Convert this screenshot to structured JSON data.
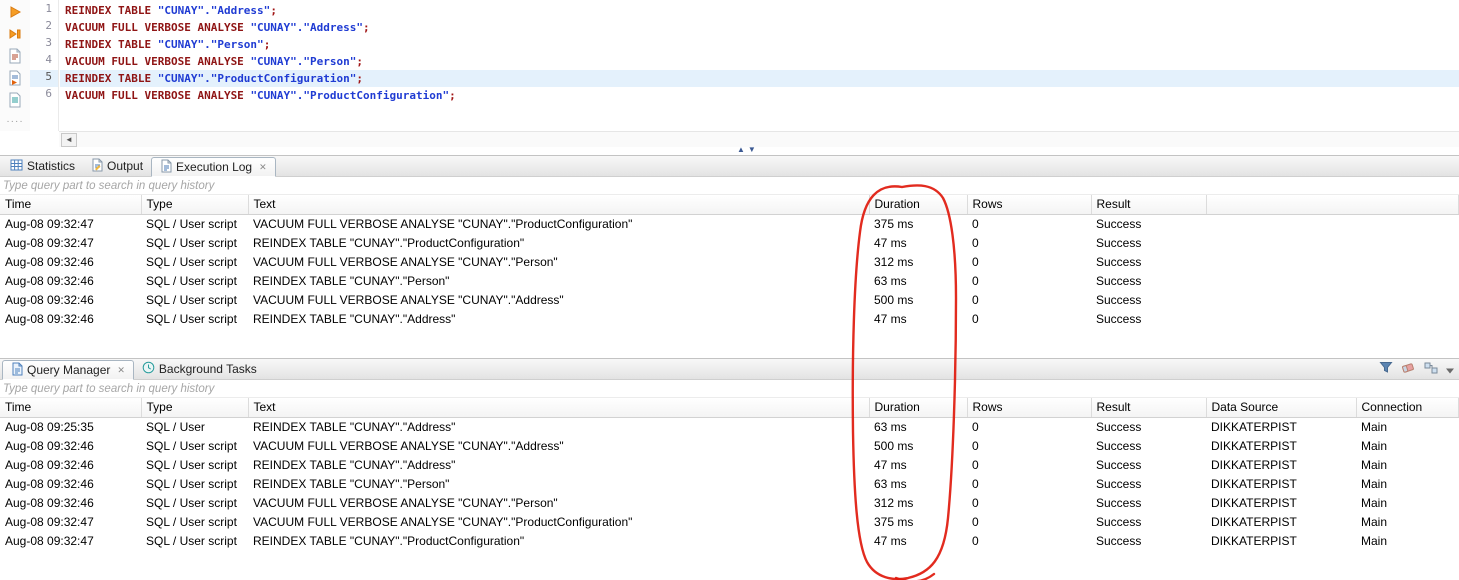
{
  "annotation": {
    "shape": "freehand-ellipse",
    "color": "#e0190c",
    "target": "Duration column values"
  },
  "editor": {
    "current_line": 5,
    "toolbar_icons": [
      "execute-statement",
      "execute-script",
      "explain-plan",
      "execute-script-file",
      "script",
      "more"
    ],
    "lines": [
      {
        "num": 1,
        "segments": [
          {
            "c": "kw",
            "t": "REINDEX TABLE "
          },
          {
            "c": "id",
            "t": "\"CUNAY\".\"Address\""
          },
          {
            "c": "pn",
            "t": ";"
          }
        ]
      },
      {
        "num": 2,
        "segments": [
          {
            "c": "kw",
            "t": "VACUUM FULL VERBOSE ANALYSE "
          },
          {
            "c": "id",
            "t": "\"CUNAY\".\"Address\""
          },
          {
            "c": "pn",
            "t": ";"
          }
        ]
      },
      {
        "num": 3,
        "segments": [
          {
            "c": "kw",
            "t": "REINDEX TABLE "
          },
          {
            "c": "id",
            "t": "\"CUNAY\".\"Person\""
          },
          {
            "c": "pn",
            "t": ";"
          }
        ]
      },
      {
        "num": 4,
        "segments": [
          {
            "c": "kw",
            "t": "VACUUM FULL VERBOSE ANALYSE "
          },
          {
            "c": "id",
            "t": "\"CUNAY\".\"Person\""
          },
          {
            "c": "pn",
            "t": ";"
          }
        ]
      },
      {
        "num": 5,
        "segments": [
          {
            "c": "kw",
            "t": "REINDEX TABLE "
          },
          {
            "c": "id",
            "t": "\"CUNAY\".\"ProductConfiguration\""
          },
          {
            "c": "pn",
            "t": ";"
          }
        ]
      },
      {
        "num": 6,
        "segments": [
          {
            "c": "kw",
            "t": "VACUUM FULL VERBOSE ANALYSE "
          },
          {
            "c": "id",
            "t": "\"CUNAY\".\"ProductConfiguration\""
          },
          {
            "c": "pn",
            "t": ";"
          }
        ]
      }
    ]
  },
  "panels": {
    "execution_log": {
      "tabs": [
        {
          "label": "Statistics"
        },
        {
          "label": "Output"
        },
        {
          "label": "Execution Log",
          "active": true,
          "closable": true
        }
      ],
      "filter_placeholder": "Type query part to search in query history",
      "columns": [
        "Time",
        "Type",
        "Text",
        "Duration",
        "Rows",
        "Result"
      ],
      "rows": [
        [
          "Aug-08 09:32:47",
          "SQL / User script",
          "VACUUM FULL VERBOSE ANALYSE \"CUNAY\".\"ProductConfiguration\"",
          "375 ms",
          "0",
          "Success"
        ],
        [
          "Aug-08 09:32:47",
          "SQL / User script",
          "REINDEX TABLE \"CUNAY\".\"ProductConfiguration\"",
          "47 ms",
          "0",
          "Success"
        ],
        [
          "Aug-08 09:32:46",
          "SQL / User script",
          "VACUUM FULL VERBOSE ANALYSE \"CUNAY\".\"Person\"",
          "312 ms",
          "0",
          "Success"
        ],
        [
          "Aug-08 09:32:46",
          "SQL / User script",
          "REINDEX TABLE \"CUNAY\".\"Person\"",
          "63 ms",
          "0",
          "Success"
        ],
        [
          "Aug-08 09:32:46",
          "SQL / User script",
          "VACUUM FULL VERBOSE ANALYSE \"CUNAY\".\"Address\"",
          "500 ms",
          "0",
          "Success"
        ],
        [
          "Aug-08 09:32:46",
          "SQL / User script",
          "REINDEX TABLE \"CUNAY\".\"Address\"",
          "47 ms",
          "0",
          "Success"
        ]
      ]
    },
    "query_manager": {
      "tabs": [
        {
          "label": "Query Manager",
          "active": true,
          "closable": true
        },
        {
          "label": "Background Tasks"
        }
      ],
      "toolbar_icons": [
        "filter-funnel",
        "clear-eraser",
        "transfer",
        "view-menu-chevron"
      ],
      "filter_placeholder": "Type query part to search in query history",
      "columns": [
        "Time",
        "Type",
        "Text",
        "Duration",
        "Rows",
        "Result",
        "Data Source",
        "Connection"
      ],
      "rows": [
        [
          "Aug-08 09:25:35",
          "SQL / User",
          "REINDEX TABLE \"CUNAY\".\"Address\"",
          "63 ms",
          "0",
          "Success",
          "DIKKATERPIST",
          "Main"
        ],
        [
          "Aug-08 09:32:46",
          "SQL / User script",
          "VACUUM FULL VERBOSE ANALYSE \"CUNAY\".\"Address\"",
          "500 ms",
          "0",
          "Success",
          "DIKKATERPIST",
          "Main"
        ],
        [
          "Aug-08 09:32:46",
          "SQL / User script",
          "REINDEX TABLE \"CUNAY\".\"Address\"",
          "47 ms",
          "0",
          "Success",
          "DIKKATERPIST",
          "Main"
        ],
        [
          "Aug-08 09:32:46",
          "SQL / User script",
          "REINDEX TABLE \"CUNAY\".\"Person\"",
          "63 ms",
          "0",
          "Success",
          "DIKKATERPIST",
          "Main"
        ],
        [
          "Aug-08 09:32:46",
          "SQL / User script",
          "VACUUM FULL VERBOSE ANALYSE \"CUNAY\".\"Person\"",
          "312 ms",
          "0",
          "Success",
          "DIKKATERPIST",
          "Main"
        ],
        [
          "Aug-08 09:32:47",
          "SQL / User script",
          "VACUUM FULL VERBOSE ANALYSE \"CUNAY\".\"ProductConfiguration\"",
          "375 ms",
          "0",
          "Success",
          "DIKKATERPIST",
          "Main"
        ],
        [
          "Aug-08 09:32:47",
          "SQL / User script",
          "REINDEX TABLE \"CUNAY\".\"ProductConfiguration\"",
          "47 ms",
          "0",
          "Success",
          "DIKKATERPIST",
          "Main"
        ]
      ]
    }
  }
}
